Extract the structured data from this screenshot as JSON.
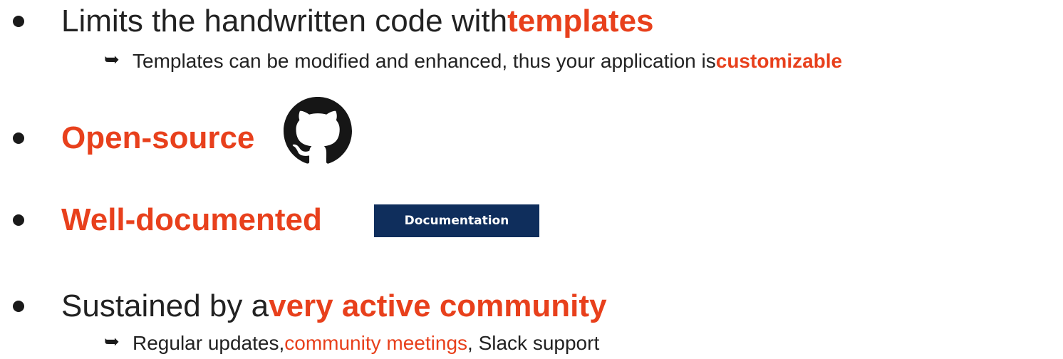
{
  "items": [
    {
      "prefix": "Limits the handwritten code with ",
      "highlight": "templates"
    },
    {
      "highlight": "Open-source"
    },
    {
      "highlight": "Well-documented"
    },
    {
      "prefix": "Sustained by a ",
      "highlight": "very active community"
    }
  ],
  "subitems": [
    {
      "prefix": "Templates can be modified and enhanced, thus your application is ",
      "highlight": "customizable"
    },
    {
      "prefix": "Regular updates, ",
      "link": "community meetings",
      "suffix": ", Slack support"
    }
  ],
  "documentation_badge": "Documentation",
  "colors": {
    "accent": "#e8401c",
    "badge_bg": "#0f2e5c",
    "text": "#222222"
  },
  "icons": {
    "sub_bullet": "➥",
    "github": "github-octocat-icon"
  }
}
